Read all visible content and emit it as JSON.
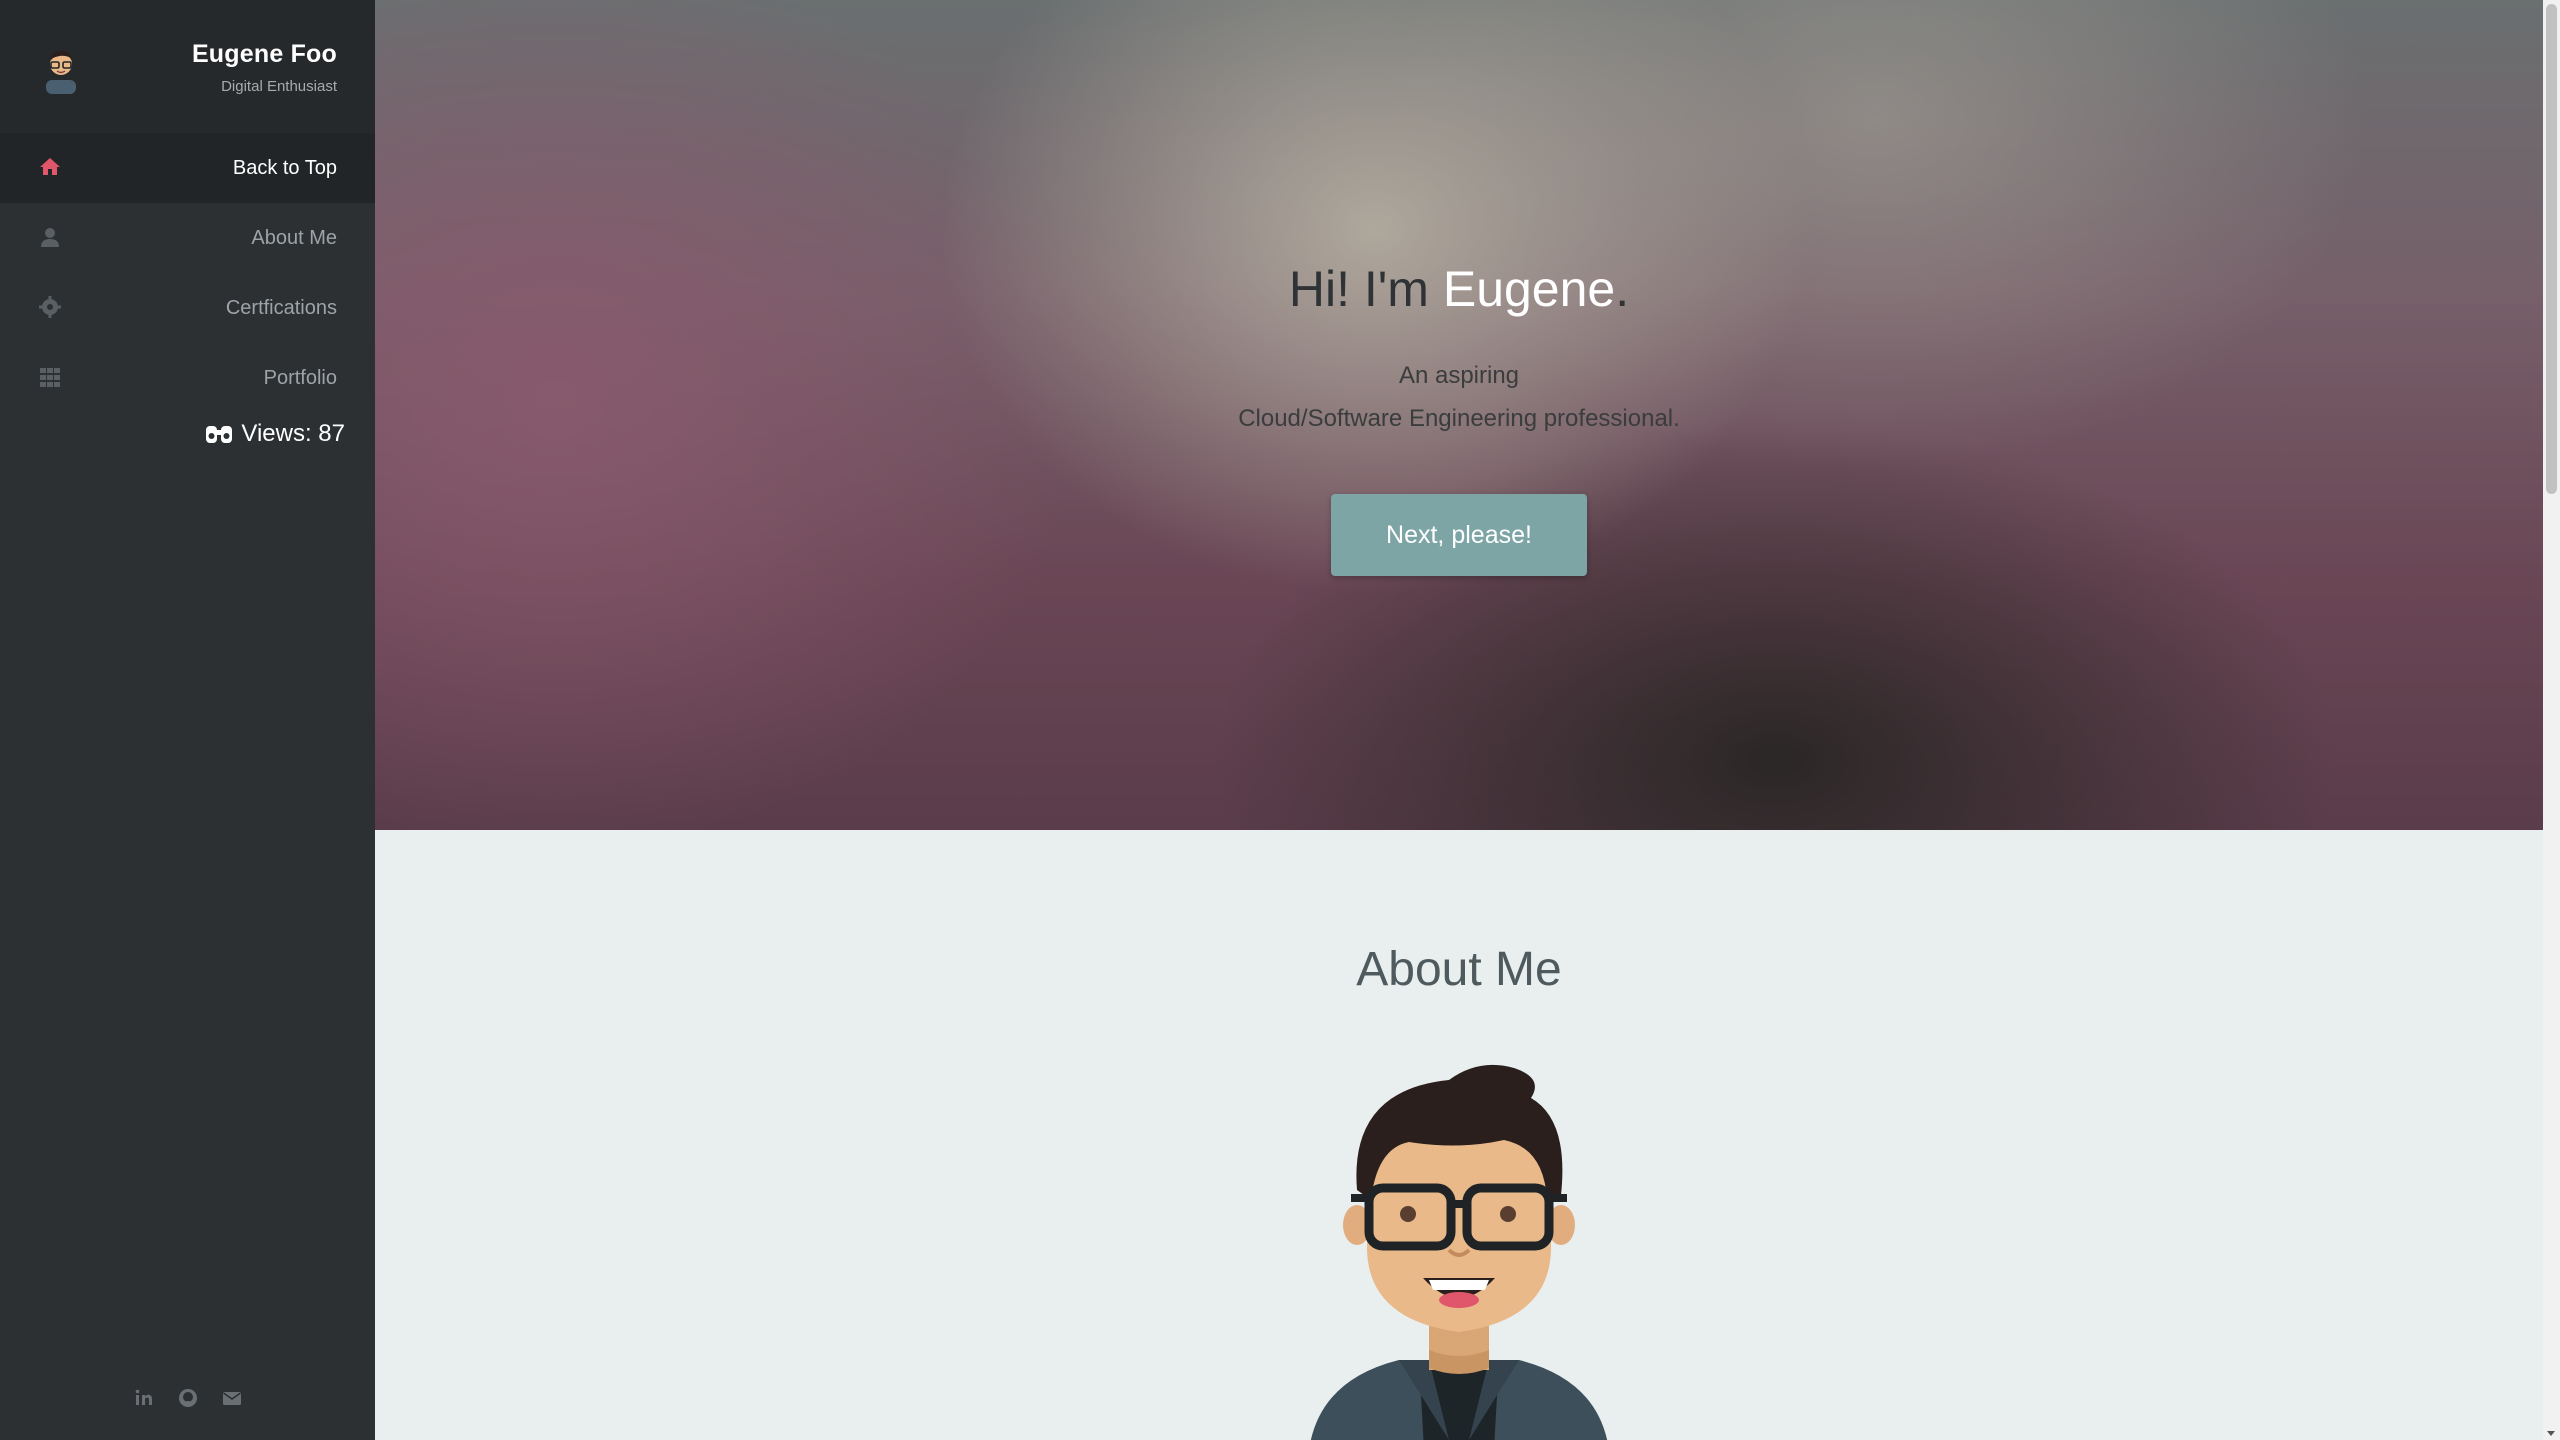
{
  "sidebar": {
    "name": "Eugene Foo",
    "tagline": "Digital Enthusiast",
    "avatar_icon": "avatar-icon",
    "items": [
      {
        "label": "Back to Top",
        "icon": "home-icon",
        "active": true
      },
      {
        "label": "About Me",
        "icon": "user-icon",
        "active": false
      },
      {
        "label": "Certfications",
        "icon": "cog-icon",
        "active": false
      },
      {
        "label": "Portfolio",
        "icon": "grid-icon",
        "active": false
      }
    ],
    "views_label": "Views: 87",
    "social": [
      "linkedin-icon",
      "github-icon",
      "envelope-icon"
    ]
  },
  "hero": {
    "title_prefix": "Hi! I'm ",
    "title_name": "Eugene",
    "title_suffix": ".",
    "line1": "An aspiring",
    "line2": "Cloud/Software Engineering professional.",
    "cta_label": "Next, please!"
  },
  "about": {
    "heading": "About Me"
  },
  "colors": {
    "sidebar_bg": "#2c3033",
    "active_icon": "#e0566b",
    "cta_bg": "#7ea5a6",
    "about_bg": "#e9eeee"
  }
}
